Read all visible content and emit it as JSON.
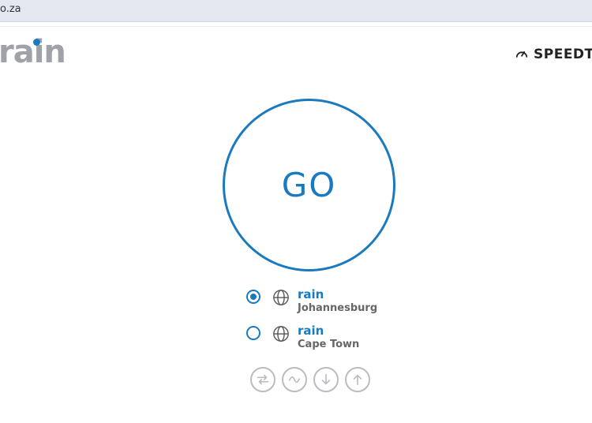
{
  "browser": {
    "url": "o.za"
  },
  "header": {
    "logo_text": "rain",
    "speedtest_label": "SPEEDT"
  },
  "main": {
    "go_label": "GO",
    "servers": [
      {
        "name": "rain",
        "city": "Johannesburg",
        "selected": true
      },
      {
        "name": "rain",
        "city": "Cape Town",
        "selected": false
      }
    ],
    "test_icons": [
      "ping-icon",
      "jitter-icon",
      "download-icon",
      "upload-icon"
    ]
  },
  "colors": {
    "accent": "#1a7ac0",
    "logo_gray": "#9fa3a8",
    "icon_gray": "#b9bcc0"
  }
}
